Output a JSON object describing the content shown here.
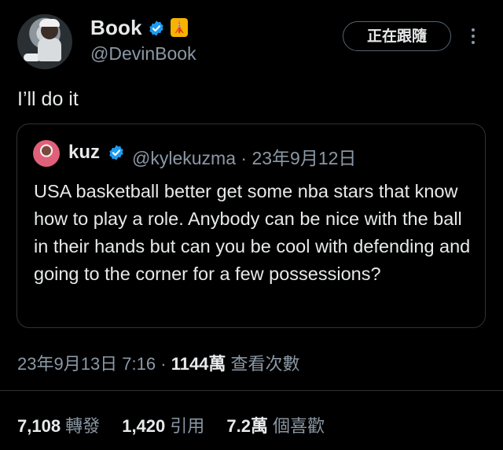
{
  "author": {
    "name": "Book",
    "handle": "@DevinBook",
    "affiliation_badge": "🗼",
    "action_button": "正在跟隨"
  },
  "tweet": {
    "text": "I’ll do it"
  },
  "quote": {
    "name": "kuz",
    "handle": "@kylekuzma",
    "separator": "·",
    "date": "23年9月12日",
    "text": "USA basketball better get some nba stars that know how to play a role. Anybody can be nice with the ball in their hands but can you be cool with defending and going to the corner for a few possessions?"
  },
  "meta": {
    "timestamp": "23年9月13日 7:16",
    "separator": "·",
    "views_count": "1144萬",
    "views_label": "查看次數"
  },
  "stats": [
    {
      "count": "7,108",
      "label": "轉發"
    },
    {
      "count": "1,420",
      "label": "引用"
    },
    {
      "count": "7.2萬",
      "label": "個喜歡"
    }
  ],
  "colors": {
    "background": "#000000",
    "text_primary": "#e7e9ea",
    "text_secondary": "#8b98a5",
    "verified_blue": "#1d9bf0",
    "border": "#2f3336"
  },
  "icons": [
    "verified-badge-icon",
    "affiliation-badge-icon",
    "more-options-icon"
  ]
}
